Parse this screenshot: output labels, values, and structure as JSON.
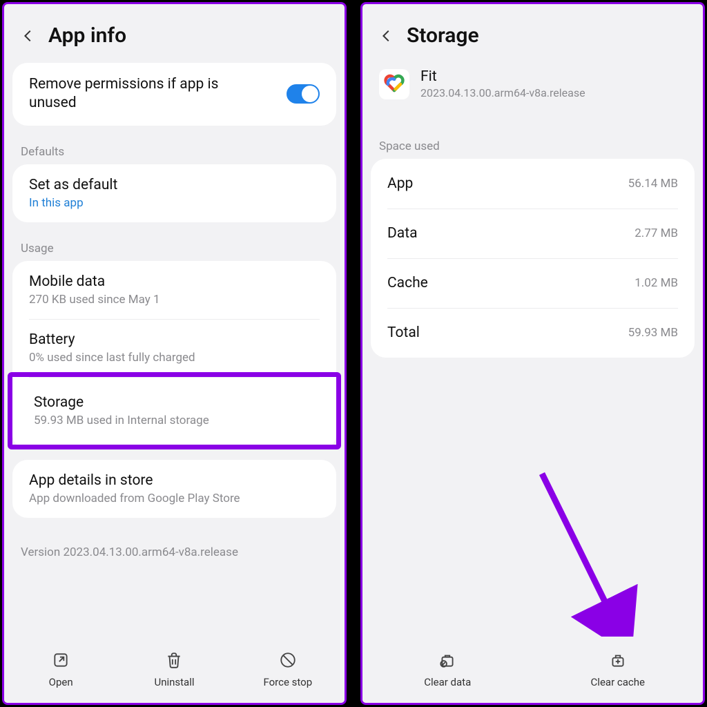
{
  "left": {
    "header_title": "App info",
    "remove_permissions_label": "Remove permissions if app is unused",
    "sections": {
      "defaults_label": "Defaults",
      "set_as_default": {
        "title": "Set as default",
        "sub": "In this app"
      },
      "usage_label": "Usage",
      "mobile_data": {
        "title": "Mobile data",
        "sub": "270 KB used since May 1"
      },
      "battery": {
        "title": "Battery",
        "sub": "0% used since last fully charged"
      },
      "storage": {
        "title": "Storage",
        "sub": "59.93 MB used in Internal storage"
      },
      "app_details": {
        "title": "App details in store",
        "sub": "App downloaded from Google Play Store"
      }
    },
    "version_line": "Version 2023.04.13.00.arm64-v8a.release",
    "bottom": {
      "open": "Open",
      "uninstall": "Uninstall",
      "force_stop": "Force stop"
    }
  },
  "right": {
    "header_title": "Storage",
    "app": {
      "name": "Fit",
      "version": "2023.04.13.00.arm64-v8a.release"
    },
    "space_used_label": "Space used",
    "rows": {
      "app": {
        "label": "App",
        "value": "56.14 MB"
      },
      "data": {
        "label": "Data",
        "value": "2.77 MB"
      },
      "cache": {
        "label": "Cache",
        "value": "1.02 MB"
      },
      "total": {
        "label": "Total",
        "value": "59.93 MB"
      }
    },
    "bottom": {
      "clear_data": "Clear data",
      "clear_cache": "Clear cache"
    }
  }
}
